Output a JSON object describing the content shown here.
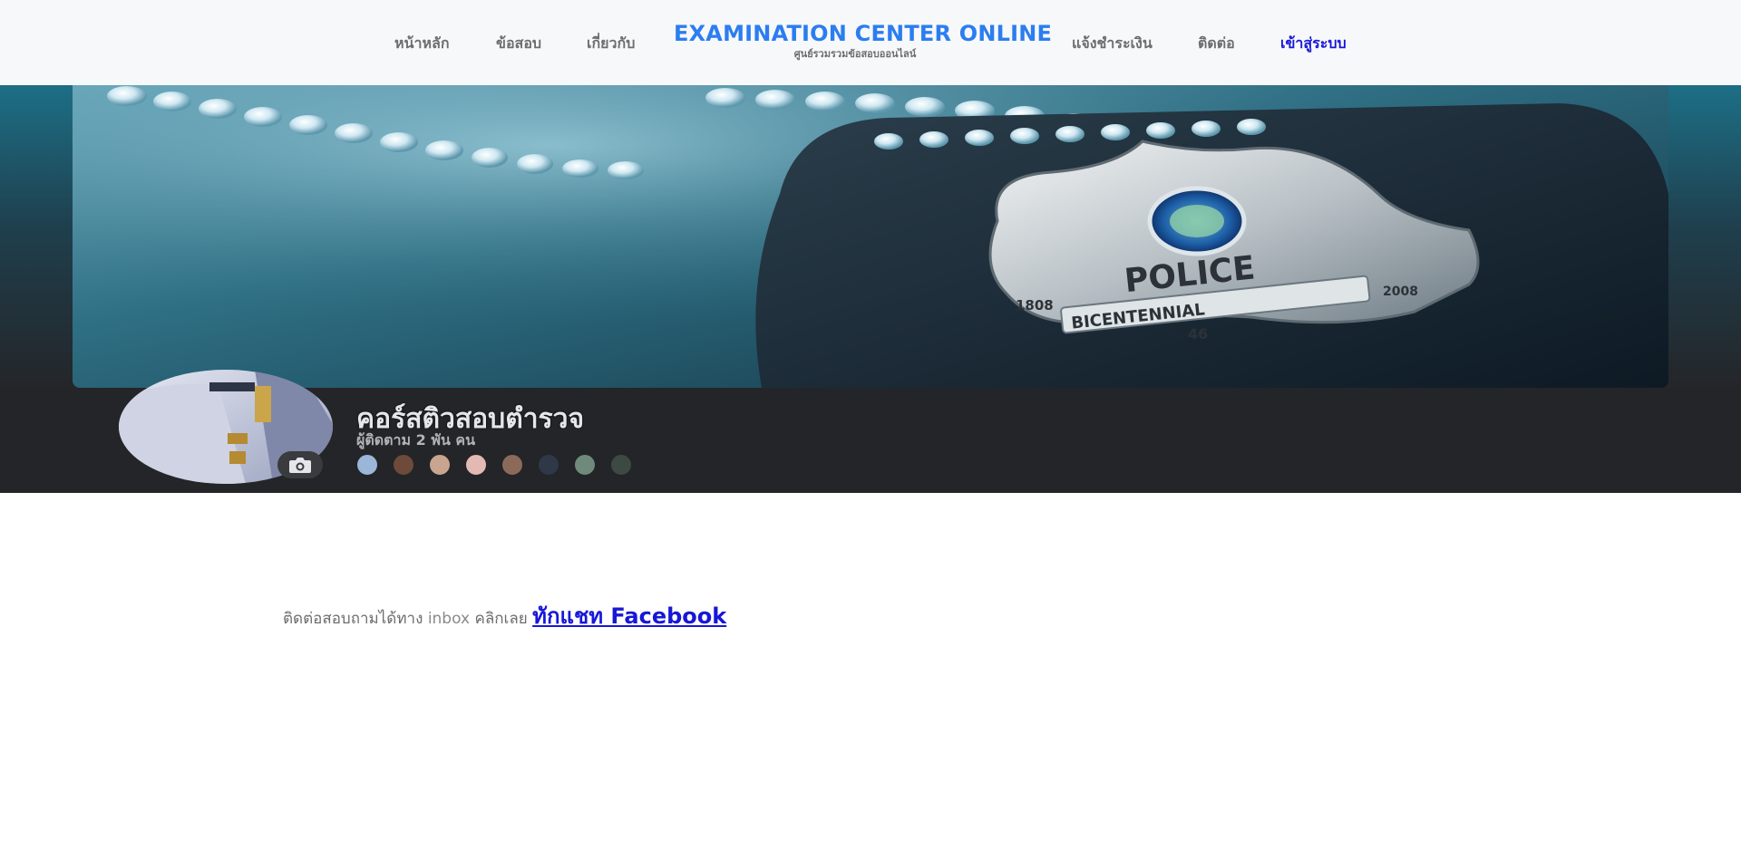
{
  "nav": {
    "home": "หน้าหลัก",
    "exam": "ข้อสอบ",
    "about": "เกี่ยวกับ",
    "payment": "แจ้งชำระเงิน",
    "contact": "ติดต่อ",
    "login": "เข้าสู่ระบบ"
  },
  "brand": {
    "title": "EXAMINATION CENTER ONLINE",
    "subtitle": "ศูนย์รวมรวมข้อสอบออนไลน์"
  },
  "hero": {
    "page_name": "คอร์สติวสอบตำรวจ",
    "followers": "ผู้ติดตาม 2 พัน คน",
    "badge_text": {
      "arc": "POLICE",
      "ribbon": "BICENTENNIAL",
      "left": "1808",
      "right": "2008",
      "number": "46"
    }
  },
  "content": {
    "contact_prefix": "ติดต่อสอบถามได้ทาง",
    "contact_inbox": "inbox",
    "contact_click": "คลิกเลย",
    "fb_link": "ทักแชท Facebook"
  },
  "colors": {
    "brand": "#2b7df0",
    "link": "#1717d6",
    "nav_text": "#6d6d6d",
    "hero_dark": "#242528"
  }
}
